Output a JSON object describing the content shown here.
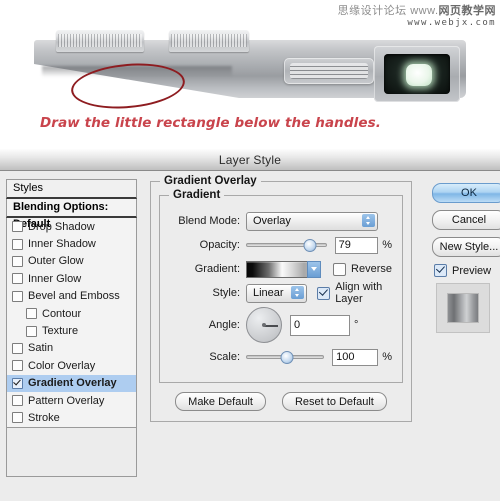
{
  "photo": {
    "caption": "Draw the little rectangle below the handles.",
    "watermark_line1_cn": "思缘设计论坛",
    "watermark_www": "www.",
    "watermark_line1_bold": "网页教学网",
    "watermark_line2": "www.webjx.com",
    "annotation_shape": "red-ellipse-highlight",
    "camera_parts": {
      "dial_left": "shutter-dial",
      "dial_right": "mode-dial",
      "grip": "textured-grip",
      "viewfinder": "viewfinder-window"
    },
    "accent_color": "#c9444c",
    "ellipse_color": "#8e1c20"
  },
  "dialog": {
    "title": "Layer Style",
    "styles": {
      "header_label": "Styles",
      "blending_options_label": "Blending Options: Default",
      "effects": [
        {
          "label": "Drop Shadow",
          "checked": false,
          "indent": false,
          "selected": false
        },
        {
          "label": "Inner Shadow",
          "checked": false,
          "indent": false,
          "selected": false
        },
        {
          "label": "Outer Glow",
          "checked": false,
          "indent": false,
          "selected": false
        },
        {
          "label": "Inner Glow",
          "checked": false,
          "indent": false,
          "selected": false
        },
        {
          "label": "Bevel and Emboss",
          "checked": false,
          "indent": false,
          "selected": false
        },
        {
          "label": "Contour",
          "checked": false,
          "indent": true,
          "selected": false
        },
        {
          "label": "Texture",
          "checked": false,
          "indent": true,
          "selected": false
        },
        {
          "label": "Satin",
          "checked": false,
          "indent": false,
          "selected": false
        },
        {
          "label": "Color Overlay",
          "checked": false,
          "indent": false,
          "selected": false
        },
        {
          "label": "Gradient Overlay",
          "checked": true,
          "indent": false,
          "selected": true
        },
        {
          "label": "Pattern Overlay",
          "checked": false,
          "indent": false,
          "selected": false
        },
        {
          "label": "Stroke",
          "checked": false,
          "indent": false,
          "selected": false
        }
      ]
    },
    "gradient_overlay": {
      "section_title": "Gradient Overlay",
      "group_title": "Gradient",
      "blend_mode": {
        "label": "Blend Mode:",
        "value": "Overlay"
      },
      "opacity": {
        "label": "Opacity:",
        "value": "79",
        "unit": "%",
        "percent": 79
      },
      "gradient": {
        "label": "Gradient:",
        "swatch_name": "black-white-gray-gradient",
        "reverse": {
          "label": "Reverse",
          "checked": false
        }
      },
      "style": {
        "label": "Style:",
        "value": "Linear",
        "align_with_layer": {
          "label": "Align with Layer",
          "checked": true
        }
      },
      "angle": {
        "label": "Angle:",
        "value": "0",
        "unit": "°",
        "degrees": 0
      },
      "scale": {
        "label": "Scale:",
        "value": "100",
        "unit": "%",
        "percent": 100
      },
      "buttons": {
        "make_default": "Make Default",
        "reset_to_default": "Reset to Default"
      }
    },
    "actions": {
      "ok": "OK",
      "cancel": "Cancel",
      "new_style": "New Style...",
      "preview": {
        "label": "Preview",
        "checked": true
      },
      "preview_thumbnail": "layer-preview-thumbnail"
    },
    "accent_color": "#7fb6e6",
    "selection_color": "#aecdf0"
  }
}
